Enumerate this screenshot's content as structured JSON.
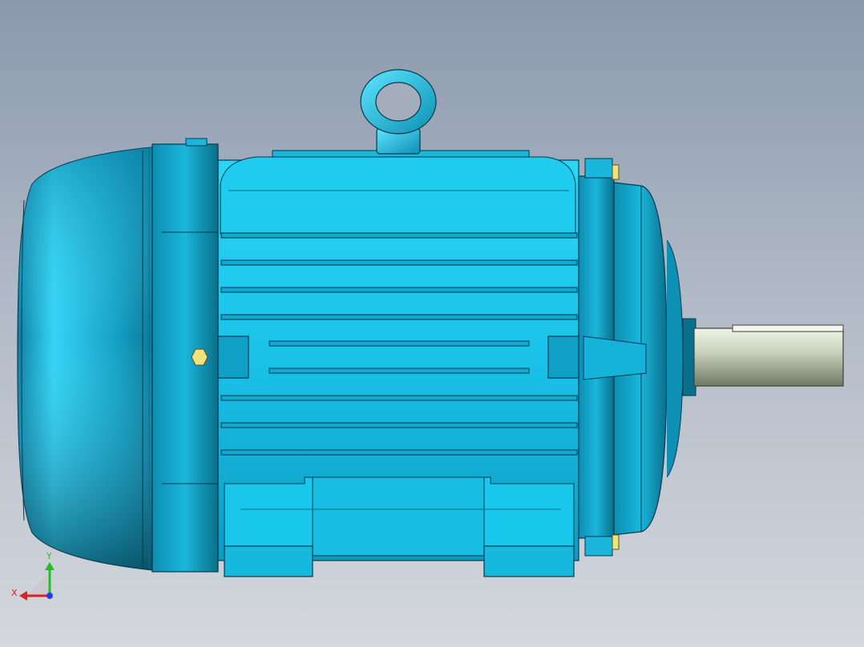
{
  "viewport": {
    "background_top": "#8a99ad",
    "background_bottom": "#d4d7dd"
  },
  "model": {
    "body_color": "#19c2e8",
    "body_dark": "#0a6f8a",
    "shaft_color": "#c9d4bf",
    "bolt_color": "#f2e27a",
    "fin_count": 9
  },
  "triad": {
    "x_label": "X",
    "y_label": "Y",
    "x_color": "#e02020",
    "y_color": "#20c020",
    "z_color": "#2040e0"
  }
}
